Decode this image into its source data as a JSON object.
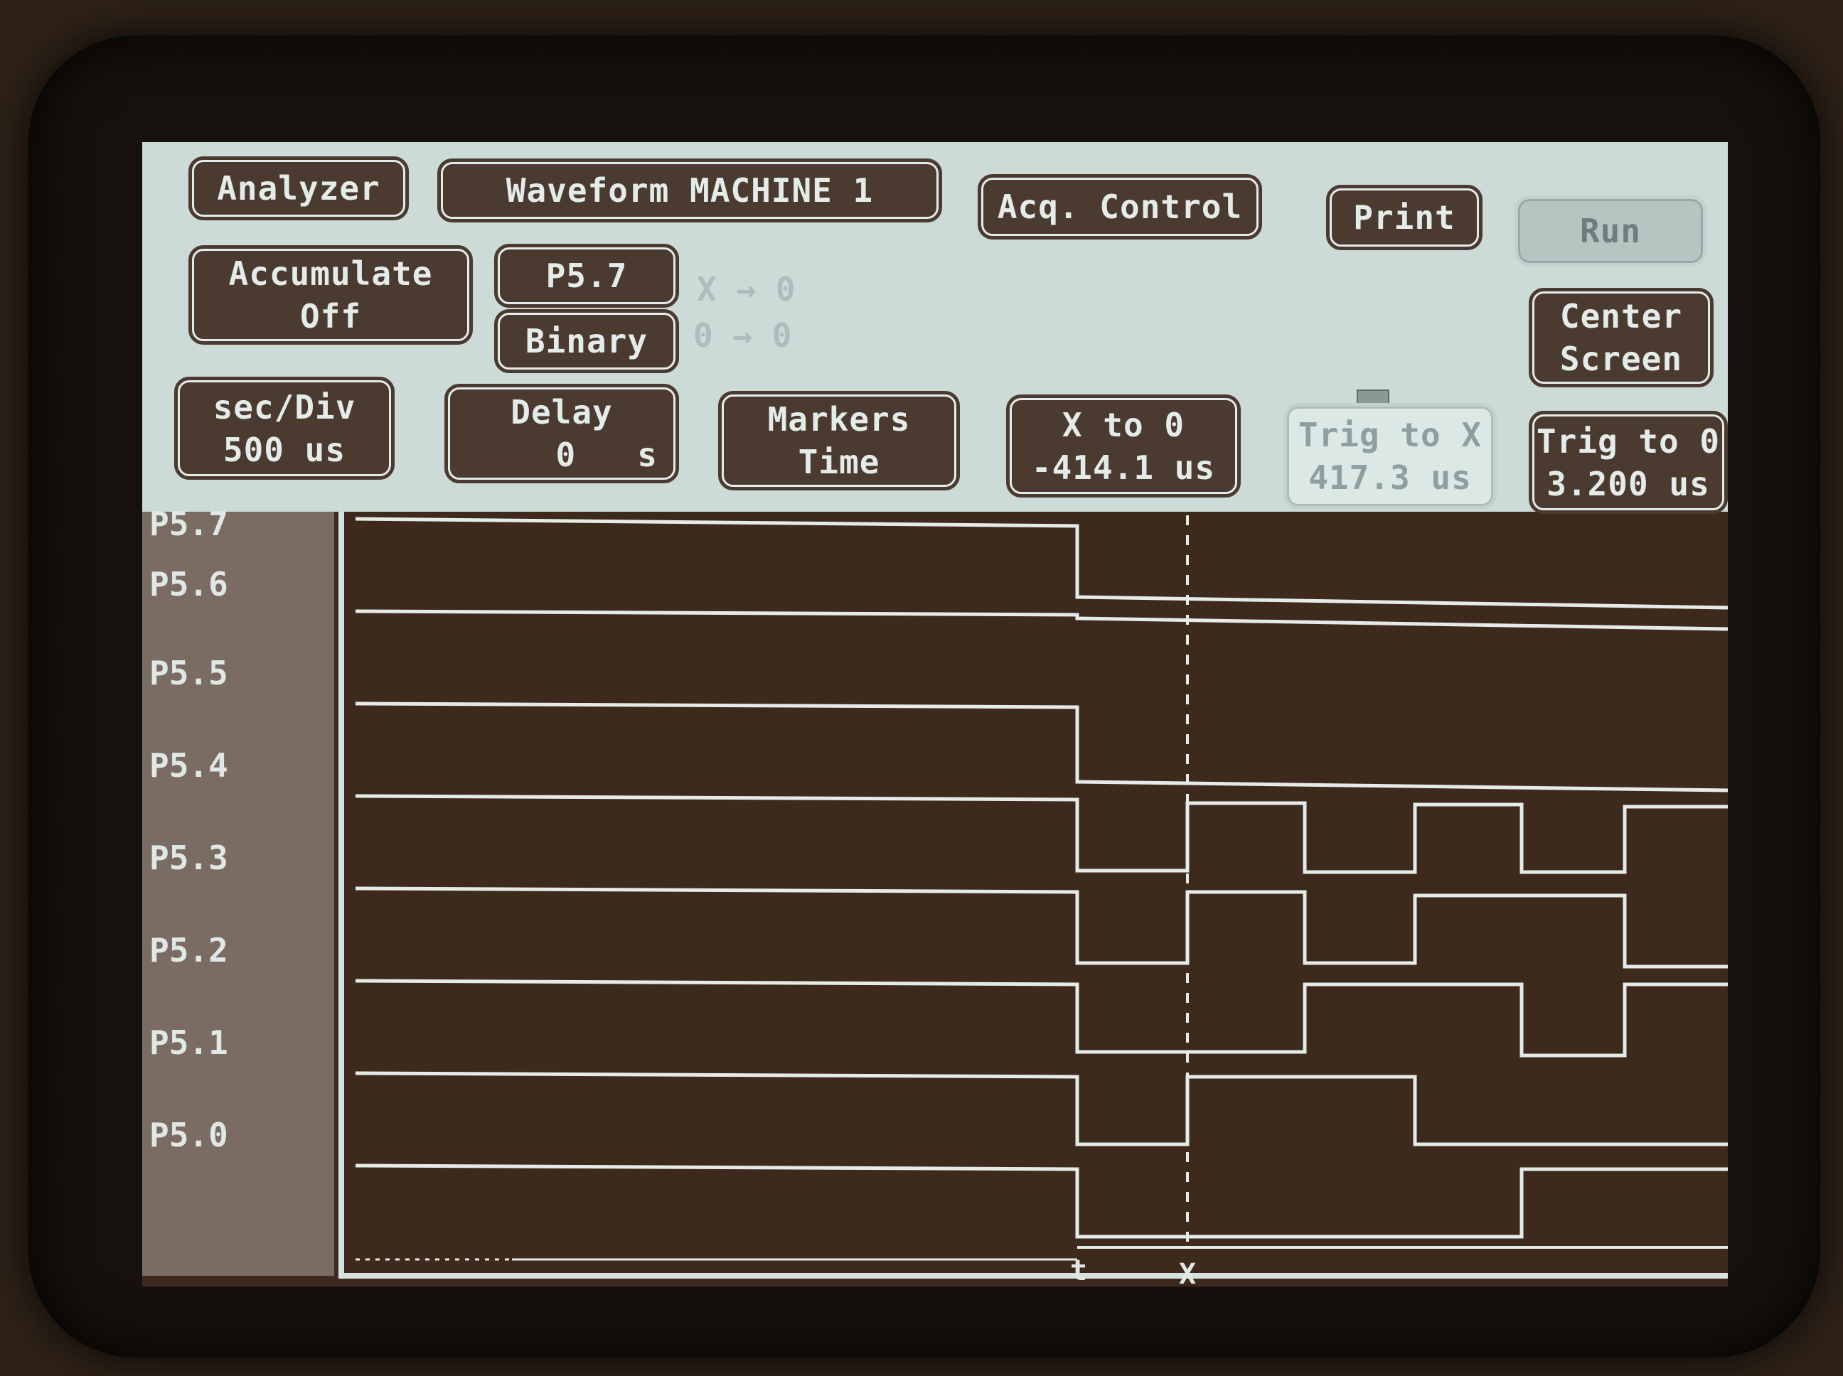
{
  "colors": {
    "panel_bg": "#ccdad8",
    "button_bg": "#4b3a2f",
    "trace": "#e4ecea",
    "wave_bg": "#3e2a1c"
  },
  "header": {
    "analyzer": "Analyzer",
    "waveform": "Waveform MACHINE 1",
    "acq_control": "Acq. Control",
    "print": "Print",
    "run": "Run"
  },
  "row2": {
    "accumulate": "Accumulate\nOff",
    "signal_select": "P5.7",
    "base_select": "Binary",
    "x_arrow": "X → 0",
    "o_arrow": "0 → 0",
    "center_screen": "Center\nScreen"
  },
  "row3": {
    "sec_div_label": "sec/Div",
    "sec_div_value": "500 us",
    "delay_label": "Delay",
    "delay_value": "0   s",
    "markers_label": "Markers",
    "markers_value": "Time",
    "x_to_o_label": "X to 0",
    "x_to_o_value": "-414.1 us",
    "trig_to_x_label": "Trig to X",
    "trig_to_x_value": "417.3 us",
    "trig_to_o_label": "Trig to 0",
    "trig_to_o_value": "3.200 us"
  },
  "signals": [
    "P5.7",
    "P5.6",
    "P5.5",
    "P5.4",
    "P5.3",
    "P5.2",
    "P5.1",
    "P5.0"
  ],
  "markers": {
    "trigger": "t",
    "x": "X"
  }
}
